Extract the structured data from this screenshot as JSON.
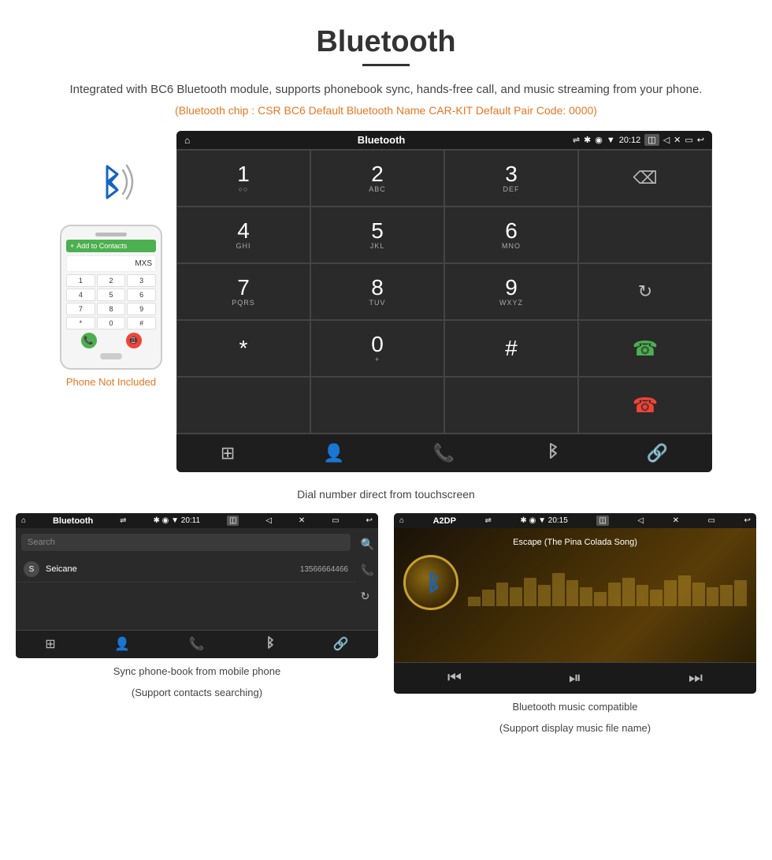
{
  "page": {
    "title": "Bluetooth",
    "description": "Integrated with BC6 Bluetooth module, supports phonebook sync, hands-free call, and music streaming from your phone.",
    "info_line": "(Bluetooth chip : CSR BC6    Default Bluetooth Name CAR-KIT    Default Pair Code: 0000)",
    "dial_caption": "Dial number direct from touchscreen",
    "phone_not_included": "Phone Not Included"
  },
  "car_screen": {
    "status_bar": {
      "home": "⌂",
      "title": "Bluetooth",
      "usb": "⇌",
      "bluetooth": "✱",
      "location": "◉",
      "wifi": "▼",
      "time": "20:12",
      "camera": "◫",
      "volume": "◁",
      "close_x": "✕",
      "window": "▭",
      "back": "↩"
    },
    "dialpad": [
      {
        "num": "1",
        "sub": "◌◌",
        "col": 1
      },
      {
        "num": "2",
        "sub": "ABC",
        "col": 1
      },
      {
        "num": "3",
        "sub": "DEF",
        "col": 1
      },
      {
        "num": "",
        "sub": "",
        "col": 1
      },
      {
        "num": "4",
        "sub": "GHI",
        "col": 2
      },
      {
        "num": "5",
        "sub": "JKL",
        "col": 2
      },
      {
        "num": "6",
        "sub": "MNO",
        "col": 2
      },
      {
        "num": "",
        "sub": "",
        "col": 2
      },
      {
        "num": "7",
        "sub": "PQRS",
        "col": 3
      },
      {
        "num": "8",
        "sub": "TUV",
        "col": 3
      },
      {
        "num": "9",
        "sub": "WXYZ",
        "col": 3
      },
      {
        "num": "",
        "sub": "",
        "col": 3
      },
      {
        "num": "*",
        "sub": "",
        "col": 4
      },
      {
        "num": "0",
        "sub": "+",
        "col": 4
      },
      {
        "num": "#",
        "sub": "",
        "col": 4
      },
      {
        "num": "",
        "sub": "",
        "col": 4
      }
    ]
  },
  "contacts_screen": {
    "status_left": "⌂",
    "status_title": "Bluetooth",
    "status_usb": "⇌",
    "status_right": "✱ ◉ ▼ 20:11",
    "search_placeholder": "Search",
    "contact_initial": "S",
    "contact_name": "Seicane",
    "contact_number": "13566664466"
  },
  "music_screen": {
    "status_left": "⌂",
    "status_title": "A2DP",
    "status_usb": "⇌",
    "status_right": "✱ ◉ ▼ 20:15",
    "song_title": "Escape (The Pina Colada Song)",
    "eq_bars": [
      20,
      35,
      50,
      40,
      60,
      45,
      70,
      55,
      40,
      30,
      50,
      60,
      45,
      35,
      55,
      65,
      50,
      40,
      45,
      55
    ]
  },
  "bottom_captions": {
    "left_main": "Sync phone-book from mobile phone",
    "left_sub": "(Support contacts searching)",
    "right_main": "Bluetooth music compatible",
    "right_sub": "(Support display music file name)"
  }
}
